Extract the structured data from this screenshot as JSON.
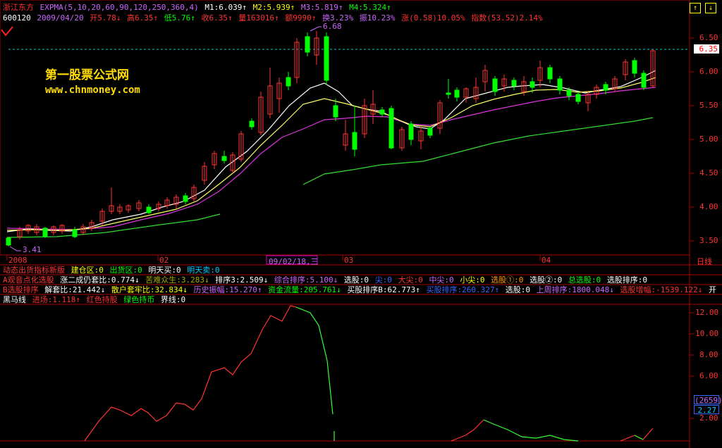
{
  "header": {
    "stock_name": "浙江东方",
    "indicator": "EXPMA(5,10,20,60,90,120,250,360,4)",
    "m1": "M1:6.039↑",
    "m2": "M2:5.939↑",
    "m3": "M3:5.819↑",
    "m4": "M4:5.324↑",
    "code": "600120",
    "date": "2009/04/20",
    "open": "开5.78↓",
    "high": "高6.35↑",
    "low": "低5.76↑",
    "close": "收6.35↑",
    "volume": "量163016↑",
    "amount": "额9990↑",
    "turnover": "换3.23%",
    "amplitude": "振10.23%",
    "change": "涨(0.58)10.05%",
    "index": "指数(53.52)2.14%"
  },
  "watermark": {
    "title": "第一股票公式网",
    "url": "www.chnmoney.com"
  },
  "price_axis": {
    "ticks": [
      "6.50",
      "6.00",
      "5.50",
      "5.00",
      "4.50",
      "4.00",
      "3.50"
    ],
    "current_price": "6.35"
  },
  "price_labels": {
    "max": "6.68",
    "min": "3.41"
  },
  "time_axis": {
    "labels": [
      "2008",
      "02",
      "09/02/18,三",
      "03",
      "04"
    ],
    "period": "日线"
  },
  "indicator_rows": {
    "row1": [
      "动态出货指标新版",
      "建仓区:0",
      "出货区:0",
      "明天买:0",
      "明天卖:0"
    ],
    "row2": [
      "A观音点化选股",
      "涨二成仍套比:0.774↓",
      "苦难众生:3.283↓",
      "排序3:2.509↓",
      "综合排序:5.100↓",
      "选股:0",
      "尖:0",
      "大尖:0",
      "中尖:0",
      "小尖:0",
      "选股①:0",
      "选股②:0",
      "总选股:0",
      "选股排序:0"
    ],
    "row3": [
      "B选股排序",
      "解套比:21.442↓",
      "散户套牢比:32.834↓",
      "历史振幅:15.270↑",
      "资金流量:205.761↓",
      "买股排序B:62.773↑",
      "买股排序:260.327↑",
      "选股:0",
      "上周排序:1800.048↓",
      "选股增幅:-1539.122↓",
      "开"
    ],
    "row4": [
      "黑马线",
      "进场:1.118↑",
      "红色持股",
      "绿色持币",
      "界线:0"
    ]
  },
  "lower_axis": {
    "ticks": [
      "12.00",
      "10.00",
      "8.00",
      "6.00",
      "2.00"
    ],
    "badge1": "(2659)",
    "badge2": "2.27"
  },
  "window_controls": {
    "up": "↑",
    "down": "↓"
  },
  "colors": {
    "up": "#ff3333",
    "down": "#00ff00",
    "bg": "#000000",
    "grid": "#aa0000"
  }
}
